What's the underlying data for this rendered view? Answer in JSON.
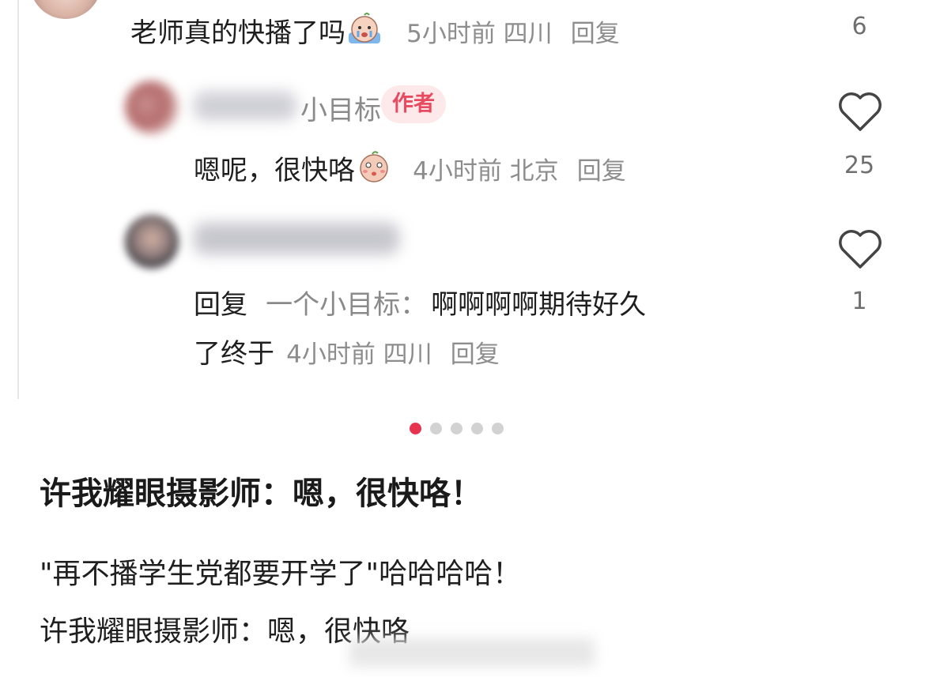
{
  "top_comment": {
    "text": "老师真的快播了吗",
    "meta": "5小时前 四川",
    "reply_label": "回复",
    "count": "6"
  },
  "reply1": {
    "name_visible": "小目标",
    "badge": "作者",
    "text": "嗯呢，很快咯",
    "meta": "4小时前 北京",
    "reply_label": "回复",
    "likes": "25"
  },
  "reply2": {
    "reply_prefix": "回复",
    "reply_target": "一个小目标：",
    "text_line1": "啊啊啊啊期待好久",
    "text_line2": "了终于",
    "meta": "4小时前 四川",
    "reply_label": "回复",
    "likes": "1"
  },
  "pagination": {
    "total": 5,
    "active": 1
  },
  "post": {
    "headline": "许我耀眼摄影师：嗯，很快咯！",
    "line1": "\"再不播学生党都要开学了\"哈哈哈哈！",
    "line2": "许我耀眼摄影师：嗯，很快咯"
  },
  "colors": {
    "badge_bg": "#fde8ea",
    "badge_text": "#e84a5f",
    "active_dot": "#e8334f",
    "meta_text": "#8d8d8d"
  },
  "icons": [
    "heart-outline-icon",
    "crying-emoji-icon",
    "shy-emoji-icon"
  ]
}
